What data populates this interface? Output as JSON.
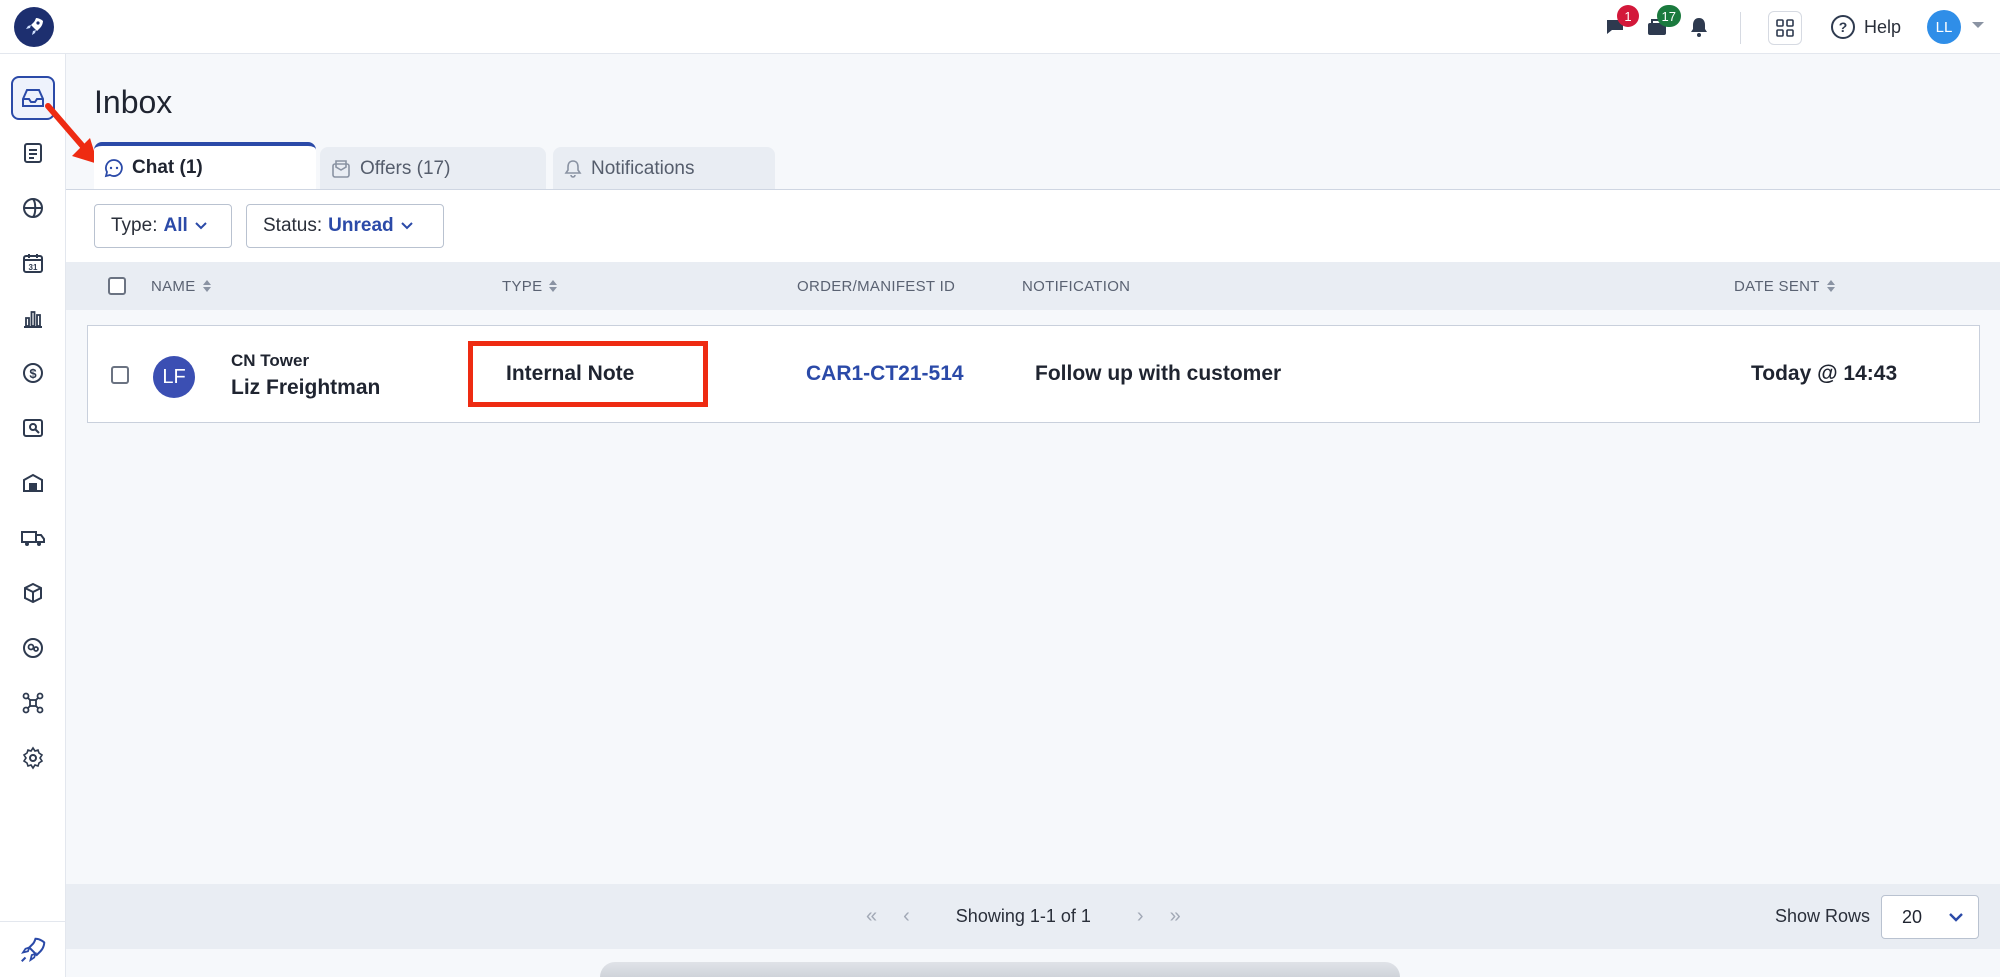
{
  "header": {
    "chat_badge": "1",
    "offers_badge": "17",
    "help_label": "Help",
    "user_initials": "LL"
  },
  "sidebar": {
    "items": [
      {
        "icon": "inbox-icon",
        "active": true
      },
      {
        "icon": "document-icon"
      },
      {
        "icon": "globe-icon"
      },
      {
        "icon": "calendar-icon",
        "text": "31"
      },
      {
        "icon": "bar-chart-icon"
      },
      {
        "icon": "dollar-icon"
      },
      {
        "icon": "profile-search-icon"
      },
      {
        "icon": "warehouse-icon"
      },
      {
        "icon": "truck-icon"
      },
      {
        "icon": "box-icon"
      },
      {
        "icon": "people-icon"
      },
      {
        "icon": "network-icon"
      },
      {
        "icon": "gear-icon"
      }
    ]
  },
  "page": {
    "title": "Inbox"
  },
  "tabs": [
    {
      "label": "Chat (1)",
      "icon": "chat-icon",
      "active": true
    },
    {
      "label": "Offers (17)",
      "icon": "offers-icon",
      "active": false
    },
    {
      "label": "Notifications",
      "icon": "bell-icon",
      "active": false
    }
  ],
  "filters": {
    "type_label": "Type:",
    "type_value": "All",
    "status_label": "Status:",
    "status_value": "Unread"
  },
  "table": {
    "columns": {
      "name": "NAME",
      "type": "TYPE",
      "order": "ORDER/MANIFEST ID",
      "notification": "NOTIFICATION",
      "date": "DATE SENT"
    },
    "rows": [
      {
        "initials": "LF",
        "company": "CN Tower",
        "person": "Liz Freightman",
        "type": "Internal Note",
        "order_id": "CAR1-CT21-514",
        "notification": "Follow up with customer",
        "date": "Today @ 14:43"
      }
    ]
  },
  "footer": {
    "pager_info": "Showing 1-1 of 1",
    "show_rows_label": "Show Rows",
    "rows_value": "20"
  },
  "colors": {
    "accent": "#2b4aa8",
    "highlight_box": "#ee2b12",
    "annotation_arrow": "#ee2b12"
  }
}
